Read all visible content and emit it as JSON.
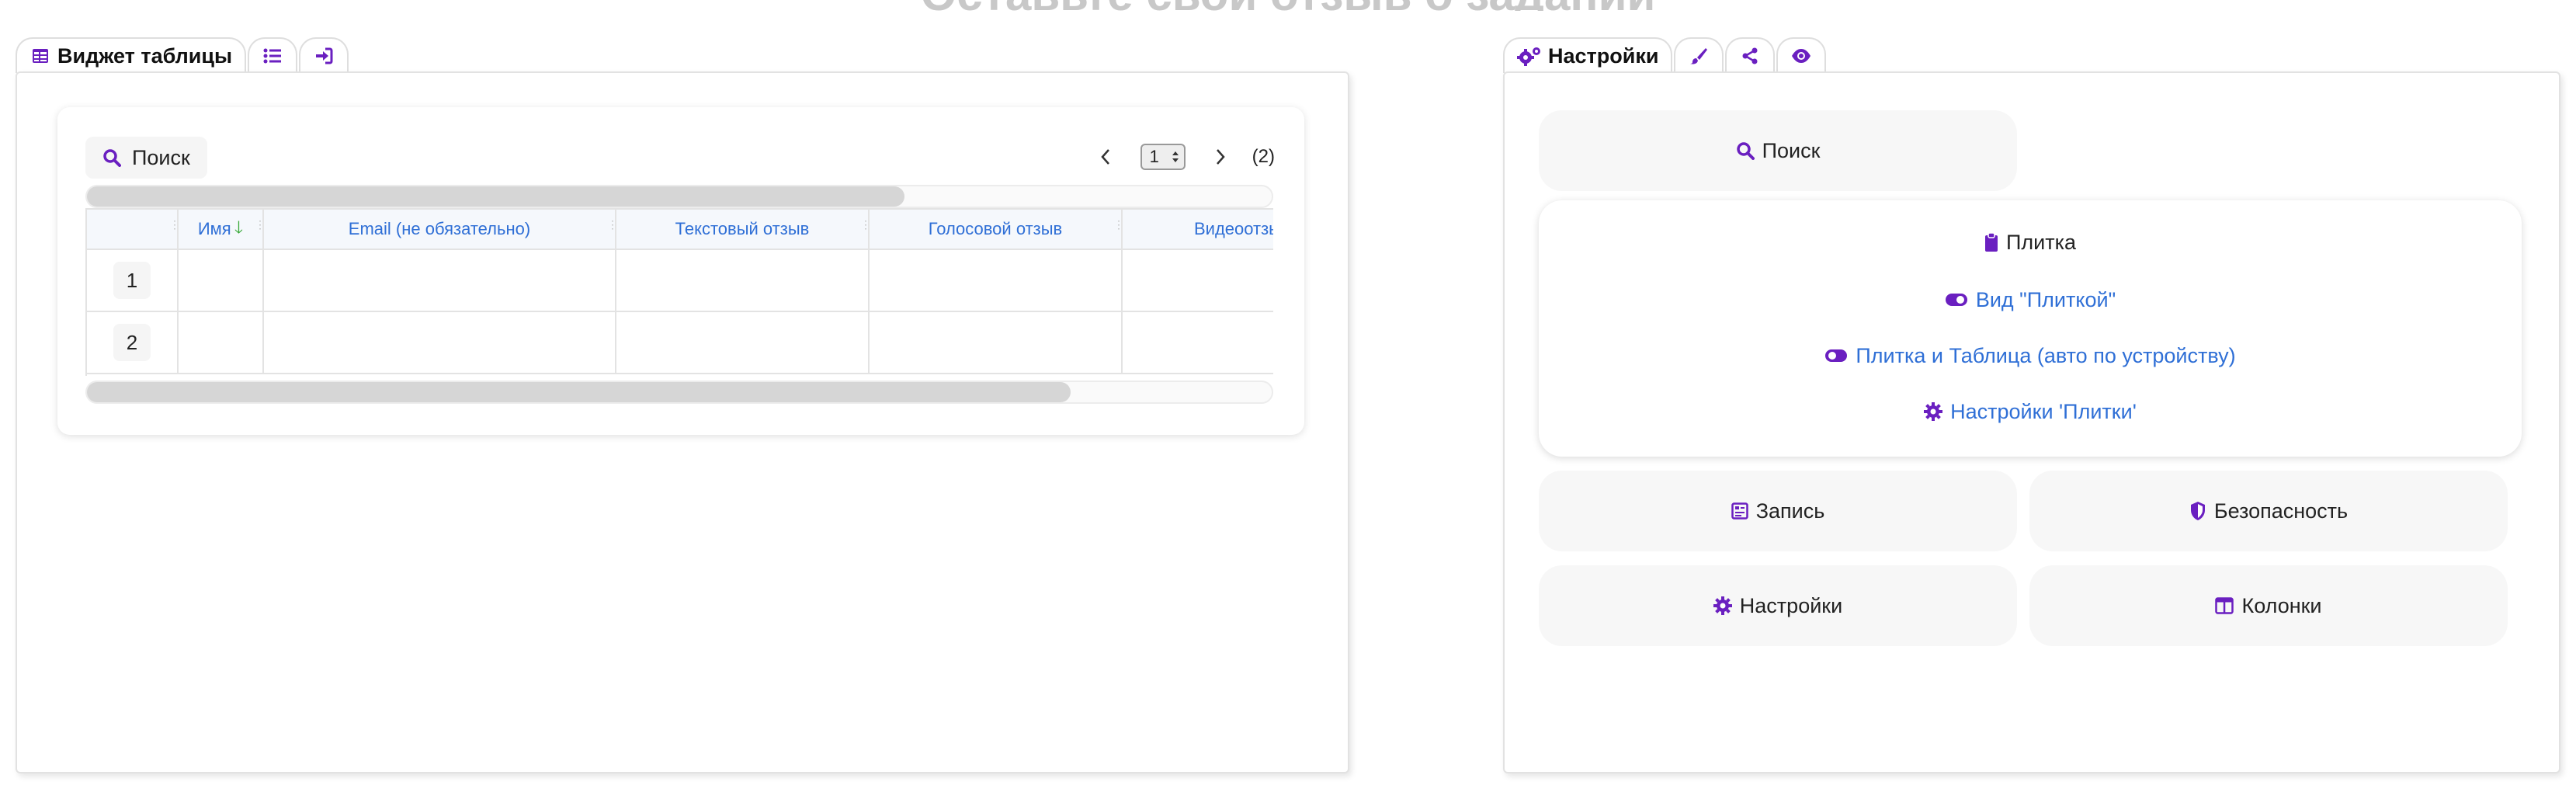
{
  "page": {
    "heading": "Оставьте свой отзыв о задании"
  },
  "left_tabs": {
    "active_label": "Виджет таблицы",
    "icons": [
      "table-icon",
      "list-icon",
      "sign-in-icon"
    ]
  },
  "widget": {
    "search_label": "Поиск",
    "pagination": {
      "current_page": "1",
      "total": "(2)"
    },
    "scroll_top_fraction": 0.69,
    "scroll_bottom_fraction": 0.83,
    "columns": [
      "",
      "Имя",
      "Email (не обязательно)",
      "Текстовый отзыв",
      "Голосовой отзыв",
      "Видеоотзыв"
    ],
    "rows": [
      {
        "num": "1",
        "cells": [
          "",
          "",
          "",
          "",
          ""
        ]
      },
      {
        "num": "2",
        "cells": [
          "",
          "",
          "",
          "",
          ""
        ]
      }
    ]
  },
  "right_tabs": {
    "active_label": "Настройки",
    "icons": [
      "cogs-icon",
      "brush-icon",
      "share-icon",
      "eye-icon"
    ]
  },
  "settings": {
    "search_label": "Поиск",
    "tile": {
      "title": "Плитка",
      "view_label": "Вид \"Плиткой\"",
      "auto_label": "Плитка и Таблица (авто по устройству)",
      "settings_label": "Настройки 'Плитки'"
    },
    "record_label": "Запись",
    "security_label": "Безопасность",
    "config_label": "Настройки",
    "columns_label": "Колонки"
  },
  "colors": {
    "accent": "#6a1fc0",
    "link": "#2f6fd6",
    "sort_arrow": "#3aaa3a"
  }
}
